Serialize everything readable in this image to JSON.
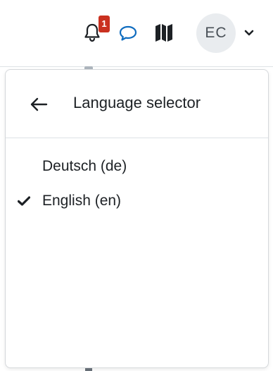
{
  "navbar": {
    "notifications_icon": "bell-icon",
    "notifications_count": "1",
    "messages_icon": "chat-bubble-icon",
    "map_icon": "map-icon",
    "user_initials": "EC",
    "user_menu_icon": "chevron-down-icon"
  },
  "dropdown": {
    "back_icon": "arrow-left-icon",
    "title": "Language selector",
    "languages": [
      {
        "label": "Deutsch (de)",
        "selected": false
      },
      {
        "label": "English (en)",
        "selected": true
      }
    ],
    "selected_icon": "checkmark-icon"
  },
  "colors": {
    "badge": "#ca3120",
    "messages_icon": "#0f6cbf",
    "avatar_bg": "#e9ecef",
    "text": "#1d2125"
  }
}
